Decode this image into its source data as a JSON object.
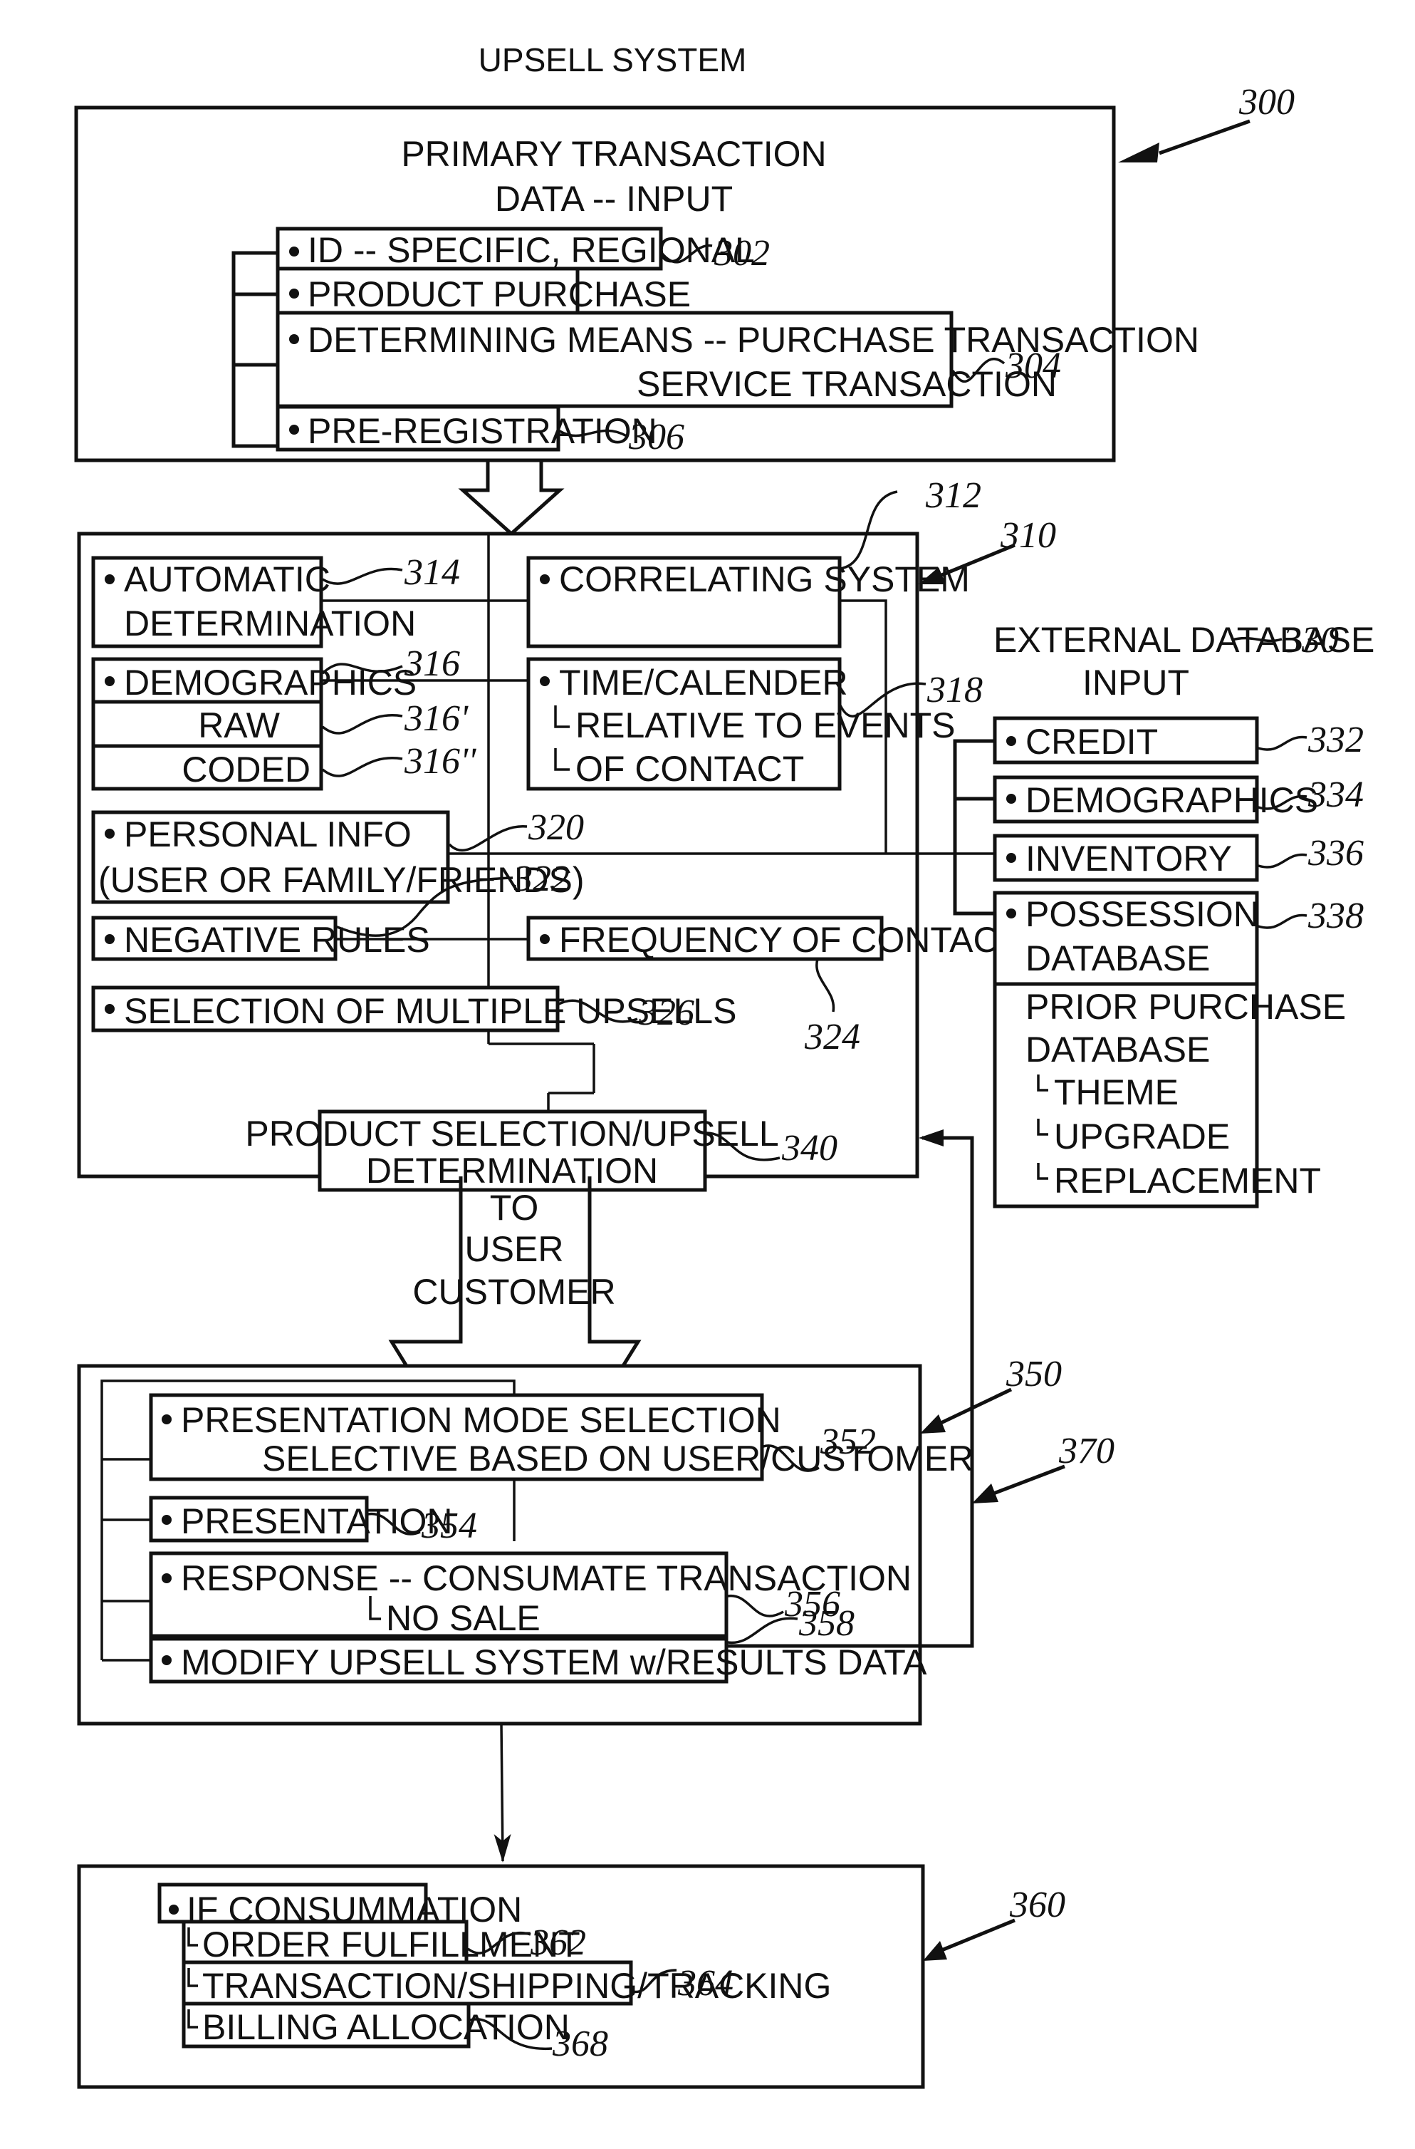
{
  "title": "UPSELL SYSTEM",
  "blocks": {
    "primary": {
      "ref": "300",
      "heading_line1": "PRIMARY TRANSACTION",
      "heading_line2": "DATA -- INPUT",
      "items": [
        {
          "text": "ID -- SPECIFIC, REGIONAL",
          "ref": "302"
        },
        {
          "text": "PRODUCT PURCHASE",
          "ref": ""
        },
        {
          "text": "DETERMINING MEANS -- PURCHASE TRANSACTION",
          "text2": "SERVICE TRANSACTION",
          "ref": "304"
        },
        {
          "text": "PRE-REGISTRATION",
          "ref": "306"
        }
      ]
    },
    "processing": {
      "ref": "310",
      "items": {
        "automatic": {
          "line1": "AUTOMATIC",
          "line2": "DETERMINATION",
          "ref": "314"
        },
        "correlating": {
          "text": "CORRELATING SYSTEM",
          "ref": "312"
        },
        "demographics": {
          "text": "DEMOGRAPHICS",
          "ref": "316",
          "raw": "RAW",
          "raw_ref": "316'",
          "coded": "CODED",
          "coded_ref": "316''"
        },
        "time": {
          "line1": "TIME/CALENDER",
          "line2": "RELATIVE TO EVENTS",
          "line3": "OF CONTACT",
          "ref": "318"
        },
        "personal": {
          "line1": "PERSONAL INFO",
          "line2": "(USER OR FAMILY/FRIENDS)",
          "ref": "320"
        },
        "negative": {
          "text": "NEGATIVE RULES",
          "ref": "322"
        },
        "frequency": {
          "text": "FREQUENCY OF CONTACT",
          "ref": "324"
        },
        "multiple": {
          "text": "SELECTION OF MULTIPLE UPSELLS",
          "ref": "326"
        },
        "product_selection": {
          "line1": "PRODUCT SELECTION/UPSELL",
          "line2": "DETERMINATION",
          "ref": "340"
        }
      }
    },
    "external": {
      "heading_line1": "EXTERNAL DATABASE",
      "heading_line2": "INPUT",
      "ref": "330",
      "items": [
        {
          "text": "CREDIT",
          "ref": "332"
        },
        {
          "text": "DEMOGRAPHICS",
          "ref": "334"
        },
        {
          "text": "INVENTORY",
          "ref": "336"
        },
        {
          "line1": "POSSESSION",
          "line2": "DATABASE",
          "ref": "338"
        }
      ],
      "prior": {
        "line1": "PRIOR PURCHASE",
        "line2": "DATABASE",
        "sub": [
          "THEME",
          "UPGRADE",
          "REPLACEMENT"
        ]
      }
    },
    "arrow_label": [
      "TO",
      "USER",
      "CUSTOMER"
    ],
    "presentation": {
      "ref": "350",
      "loop_ref": "370",
      "items": [
        {
          "line1": "PRESENTATION MODE SELECTION",
          "line2": "SELECTIVE BASED ON USER/CUSTOMER",
          "ref": "352"
        },
        {
          "text": "PRESENTATION",
          "ref": "354"
        },
        {
          "line1": "RESPONSE -- CONSUMATE TRANSACTION",
          "line2": "NO SALE",
          "ref": "356"
        },
        {
          "text": "MODIFY UPSELL SYSTEM w/RESULTS DATA",
          "ref": "358"
        }
      ]
    },
    "fulfillment": {
      "ref": "360",
      "head": "IF CONSUMMATION",
      "items": [
        {
          "text": "ORDER FULFILLMENT",
          "ref": "362"
        },
        {
          "text": "TRANSACTION/SHIPPING/TRACKING",
          "ref": "364"
        },
        {
          "text": "BILLING ALLOCATION",
          "ref": "368"
        }
      ]
    }
  }
}
